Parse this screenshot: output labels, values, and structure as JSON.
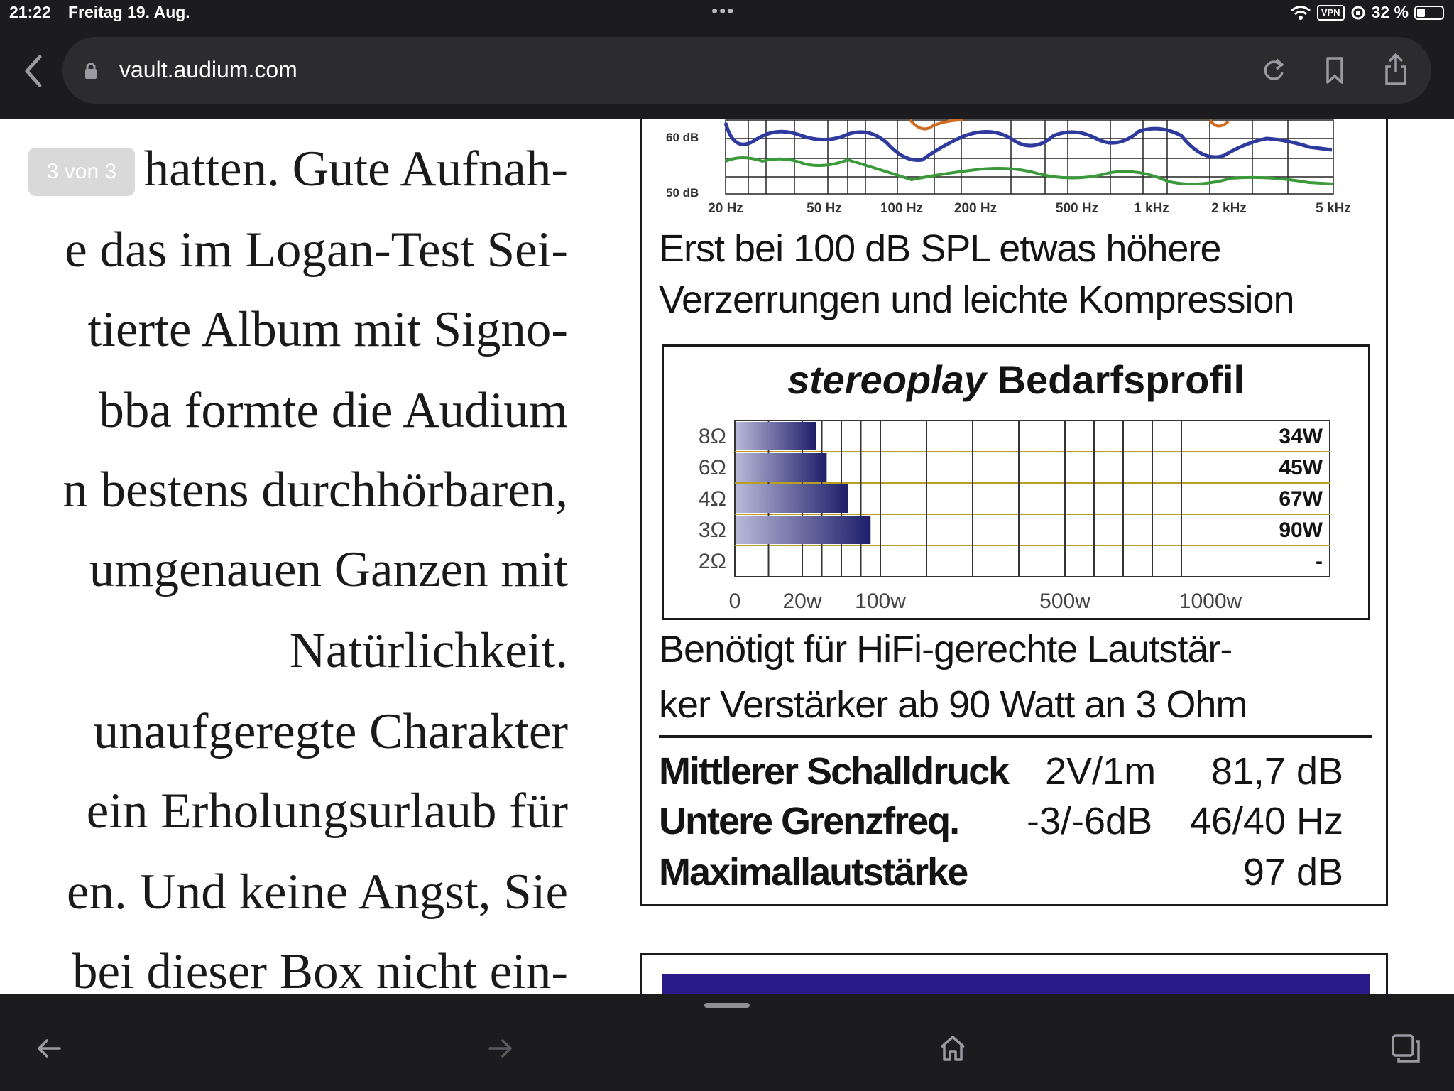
{
  "status_bar": {
    "time": "21:22",
    "date": "Freitag 19. Aug.",
    "vpn": "VPN",
    "battery": "32 %",
    "battery_level": 0.32
  },
  "browser": {
    "url": "vault.audium.com"
  },
  "page_indicator": "3 von 3",
  "article_lines": [
    "hatten. Gute Aufnah-",
    "e das im Logan-Test Sei-",
    "tierte Album mit Signo-",
    "bba formte die Audium",
    "n bestens durchhörbaren,",
    "umgenauen Ganzen mit",
    "Natürlichkeit.",
    "unaufgeregte Charakter",
    "ein Erholungsurlaub für",
    "en. Und keine Angst, Sie",
    "bei dieser Box nicht ein-"
  ],
  "frequency_chart": {
    "y_labels": [
      "60 dB",
      "50 dB"
    ],
    "x_labels": [
      "20 Hz",
      "50 Hz",
      "100 Hz",
      "200 Hz",
      "500 Hz",
      "1 kHz",
      "2 kHz",
      "5 kHz"
    ],
    "colors": {
      "blue": "#2e3a9e",
      "green": "#3a9a3a",
      "orange": "#d06a20"
    }
  },
  "caption_1": [
    "Erst bei 100 dB SPL etwas höhere",
    "Verzerrungen und leichte Kompression"
  ],
  "bedarfsprofil": {
    "title_brand": "stereoplay",
    "title_rest": " Bedarfsprofil",
    "chart_data": {
      "type": "bar",
      "categories": [
        "8Ω",
        "6Ω",
        "4Ω",
        "3Ω",
        "2Ω"
      ],
      "values": [
        34,
        45,
        67,
        90,
        null
      ],
      "value_labels": [
        "34W",
        "45W",
        "67W",
        "90W",
        "-"
      ],
      "x_tick_labels": [
        "0",
        "20w",
        "100w",
        "500w",
        "1000w"
      ]
    }
  },
  "caption_2": [
    "Benötigt für HiFi-gerechte Lautstär-",
    "ker Verstärker ab 90 Watt an 3 Ohm"
  ],
  "specs": [
    {
      "label": "Mittlerer Schalldruck",
      "condition": "2V/1m",
      "value": "81,7 dB"
    },
    {
      "label": "Untere Grenzfreq.",
      "condition": "-3/-6dB",
      "value": "46/40 Hz"
    },
    {
      "label": "Maximallautstärke",
      "condition": "",
      "value": "97 dB"
    }
  ]
}
